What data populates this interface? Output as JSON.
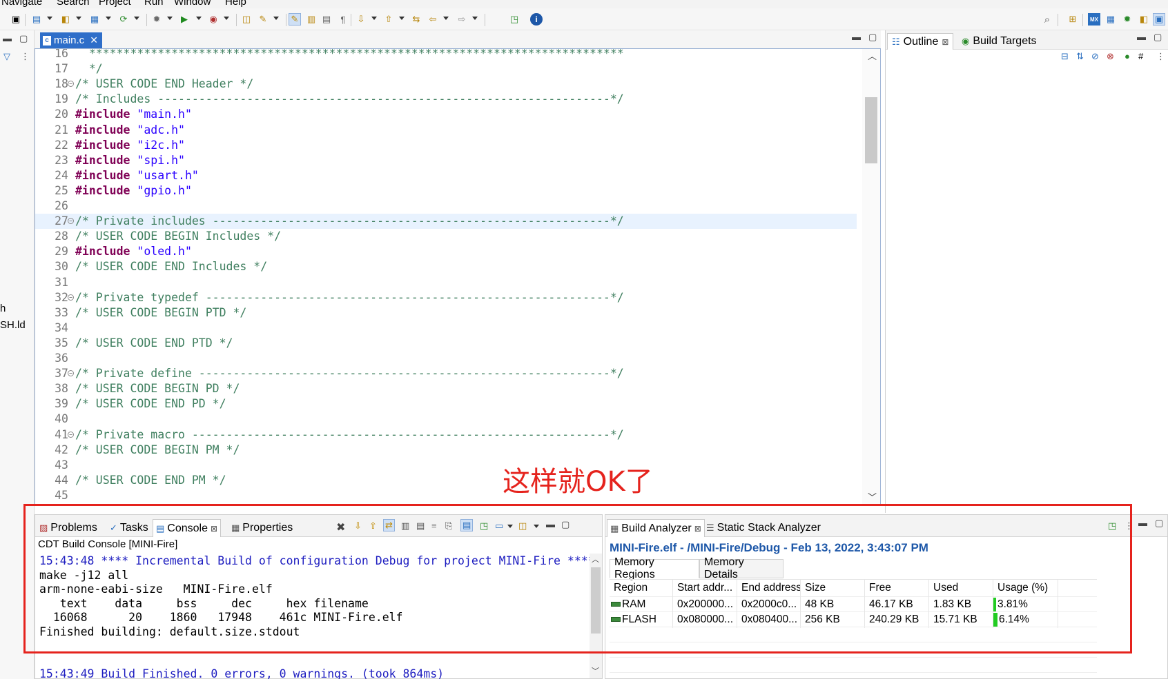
{
  "menu": [
    "Navigate",
    "Search",
    "Project",
    "Run",
    "Window",
    "Help"
  ],
  "left_strip": {
    "items": [
      "h",
      "SH.ld"
    ]
  },
  "editor": {
    "tab_label": "main.c",
    "lines": [
      {
        "n": "16",
        "fold": false,
        "parts": [
          {
            "t": "  ******************************************************************************",
            "c": "comment"
          }
        ]
      },
      {
        "n": "17",
        "fold": false,
        "parts": [
          {
            "t": "  */",
            "c": "comment"
          }
        ]
      },
      {
        "n": "18",
        "fold": true,
        "parts": [
          {
            "t": "/* USER CODE END Header */",
            "c": "comment"
          }
        ]
      },
      {
        "n": "19",
        "fold": false,
        "parts": [
          {
            "t": "/* Includes ------------------------------------------------------------------*/",
            "c": "comment"
          }
        ]
      },
      {
        "n": "20",
        "fold": false,
        "parts": [
          {
            "t": "#include",
            "c": "kw"
          },
          {
            "t": " "
          },
          {
            "t": "\"main.h\"",
            "c": "str"
          }
        ]
      },
      {
        "n": "21",
        "fold": false,
        "parts": [
          {
            "t": "#include",
            "c": "kw"
          },
          {
            "t": " "
          },
          {
            "t": "\"adc.h\"",
            "c": "str"
          }
        ]
      },
      {
        "n": "22",
        "fold": false,
        "parts": [
          {
            "t": "#include",
            "c": "kw"
          },
          {
            "t": " "
          },
          {
            "t": "\"i2c.h\"",
            "c": "str"
          }
        ]
      },
      {
        "n": "23",
        "fold": false,
        "parts": [
          {
            "t": "#include",
            "c": "kw"
          },
          {
            "t": " "
          },
          {
            "t": "\"spi.h\"",
            "c": "str"
          }
        ]
      },
      {
        "n": "24",
        "fold": false,
        "parts": [
          {
            "t": "#include",
            "c": "kw"
          },
          {
            "t": " "
          },
          {
            "t": "\"usart.h\"",
            "c": "str"
          }
        ]
      },
      {
        "n": "25",
        "fold": false,
        "parts": [
          {
            "t": "#include",
            "c": "kw"
          },
          {
            "t": " "
          },
          {
            "t": "\"gpio.h\"",
            "c": "str"
          }
        ]
      },
      {
        "n": "26",
        "fold": false,
        "parts": []
      },
      {
        "n": "27",
        "fold": true,
        "parts": [
          {
            "t": "/* Private includes ----------------------------------------------------------*/",
            "c": "comment"
          }
        ]
      },
      {
        "n": "28",
        "fold": false,
        "parts": [
          {
            "t": "/* USER CODE BEGIN Includes */",
            "c": "comment"
          }
        ]
      },
      {
        "n": "29",
        "fold": false,
        "parts": [
          {
            "t": "#include",
            "c": "kw"
          },
          {
            "t": " "
          },
          {
            "t": "\"oled.h\"",
            "c": "str"
          }
        ]
      },
      {
        "n": "30",
        "fold": false,
        "parts": [
          {
            "t": "/* USER CODE END Includes */",
            "c": "comment"
          }
        ]
      },
      {
        "n": "31",
        "fold": false,
        "parts": []
      },
      {
        "n": "32",
        "fold": true,
        "parts": [
          {
            "t": "/* Private typedef -----------------------------------------------------------*/",
            "c": "comment"
          }
        ]
      },
      {
        "n": "33",
        "fold": false,
        "parts": [
          {
            "t": "/* USER CODE BEGIN PTD */",
            "c": "comment"
          }
        ]
      },
      {
        "n": "34",
        "fold": false,
        "parts": []
      },
      {
        "n": "35",
        "fold": false,
        "parts": [
          {
            "t": "/* USER CODE END PTD */",
            "c": "comment"
          }
        ]
      },
      {
        "n": "36",
        "fold": false,
        "parts": []
      },
      {
        "n": "37",
        "fold": true,
        "parts": [
          {
            "t": "/* Private define ------------------------------------------------------------*/",
            "c": "comment"
          }
        ]
      },
      {
        "n": "38",
        "fold": false,
        "parts": [
          {
            "t": "/* USER CODE BEGIN PD */",
            "c": "comment"
          }
        ]
      },
      {
        "n": "39",
        "fold": false,
        "parts": [
          {
            "t": "/* USER CODE END PD */",
            "c": "comment"
          }
        ]
      },
      {
        "n": "40",
        "fold": false,
        "parts": []
      },
      {
        "n": "41",
        "fold": true,
        "parts": [
          {
            "t": "/* Private macro -------------------------------------------------------------*/",
            "c": "comment"
          }
        ]
      },
      {
        "n": "42",
        "fold": false,
        "parts": [
          {
            "t": "/* USER CODE BEGIN PM */",
            "c": "comment"
          }
        ]
      },
      {
        "n": "43",
        "fold": false,
        "parts": []
      },
      {
        "n": "44",
        "fold": false,
        "parts": [
          {
            "t": "/* USER CODE END PM */",
            "c": "comment"
          }
        ]
      },
      {
        "n": "45",
        "fold": false,
        "parts": []
      }
    ],
    "highlighted_line": "27"
  },
  "right_panel": {
    "tabs": [
      "Outline",
      "Build Targets"
    ]
  },
  "bottom_left": {
    "tabs": [
      "Problems",
      "Tasks",
      "Console",
      "Properties"
    ],
    "active_tab": "Console",
    "console_title": "CDT Build Console [MINI-Fire]",
    "console_lines": [
      {
        "t": "15:43:48 **** Incremental Build of configuration Debug for project MINI-Fire ****",
        "c": "blue"
      },
      {
        "t": "make -j12 all",
        "c": "black"
      },
      {
        "t": "arm-none-eabi-size   MINI-Fire.elf",
        "c": "black"
      },
      {
        "t": "   text    data     bss     dec     hex filename",
        "c": "black"
      },
      {
        "t": "  16068      20    1860   17948    461c MINI-Fire.elf",
        "c": "black"
      },
      {
        "t": "Finished building: default.size.stdout",
        "c": "black"
      },
      {
        "t": "",
        "c": "black"
      },
      {
        "t": "",
        "c": "black"
      },
      {
        "t": "15:43:49 Build Finished. 0 errors, 0 warnings. (took 864ms)",
        "c": "blue"
      }
    ]
  },
  "bottom_right": {
    "tabs": [
      "Build Analyzer",
      "Static Stack Analyzer"
    ],
    "title": "MINI-Fire.elf - /MINI-Fire/Debug - Feb 13, 2022, 3:43:07 PM",
    "subtabs": [
      "Memory Regions",
      "Memory Details"
    ],
    "columns": [
      "Region",
      "Start addr...",
      "End address",
      "Size",
      "Free",
      "Used",
      "Usage (%)"
    ],
    "rows": [
      {
        "region": "RAM",
        "start": "0x200000...",
        "end": "0x2000c0...",
        "size": "48 KB",
        "free": "46.17 KB",
        "used": "1.83 KB",
        "usage": "3.81%",
        "usage_fraction": 0.0381
      },
      {
        "region": "FLASH",
        "start": "0x080000...",
        "end": "0x080400...",
        "size": "256 KB",
        "free": "240.29 KB",
        "used": "15.71 KB",
        "usage": "6.14%",
        "usage_fraction": 0.0614
      }
    ]
  },
  "annotation": {
    "text": "这样就OK了",
    "color": "#e5231d"
  },
  "colors": {
    "tab_active": "#2e6ec9",
    "link_blue": "#1d57a8",
    "usage_green": "#22cc22",
    "highlight_box": "#e5231d"
  }
}
